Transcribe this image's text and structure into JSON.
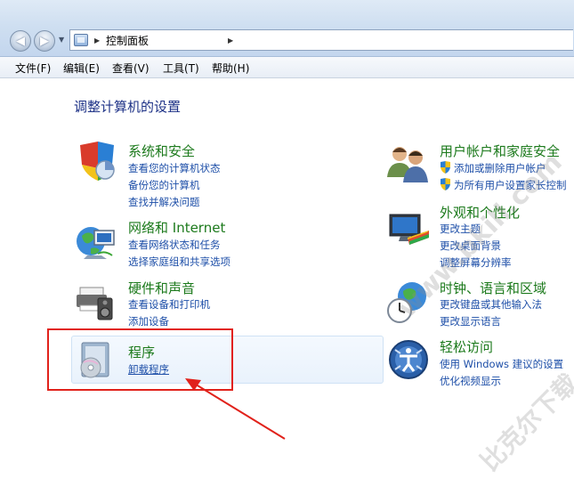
{
  "address": {
    "path": "控制面板"
  },
  "menu": [
    "文件(F)",
    "编辑(E)",
    "查看(V)",
    "工具(T)",
    "帮助(H)"
  ],
  "page_title": "调整计算机的设置",
  "categories": {
    "system_security": {
      "title": "系统和安全",
      "links": [
        "查看您的计算机状态",
        "备份您的计算机",
        "查找并解决问题"
      ]
    },
    "network": {
      "title": "网络和 Internet",
      "links": [
        "查看网络状态和任务",
        "选择家庭组和共享选项"
      ]
    },
    "hardware": {
      "title": "硬件和声音",
      "links": [
        "查看设备和打印机",
        "添加设备"
      ]
    },
    "programs": {
      "title": "程序",
      "links": [
        "卸载程序"
      ]
    },
    "user_accounts": {
      "title": "用户帐户和家庭安全",
      "links": [
        "添加或删除用户帐户",
        "为所有用户设置家长控制"
      ]
    },
    "appearance": {
      "title": "外观和个性化",
      "links": [
        "更改主题",
        "更改桌面背景",
        "调整屏幕分辨率"
      ]
    },
    "clock": {
      "title": "时钟、语言和区域",
      "links": [
        "更改键盘或其他输入法",
        "更改显示语言"
      ]
    },
    "ease": {
      "title": "轻松访问",
      "links": [
        "使用 Windows 建议的设置",
        "优化视频显示"
      ]
    }
  },
  "watermark": {
    "line1": "比克尔下载",
    "line2": "www.bkill.com"
  },
  "colors": {
    "category_title": "#1c7a1c",
    "link": "#1e4fa8",
    "annotation": "#e1221b"
  }
}
